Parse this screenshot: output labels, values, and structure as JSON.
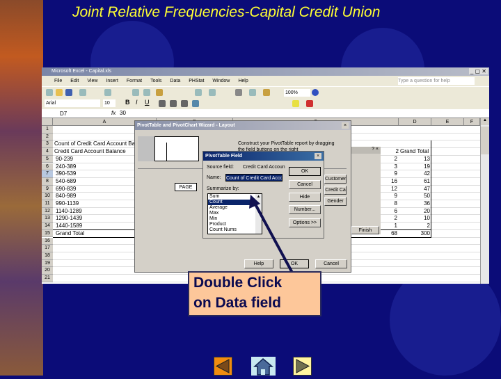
{
  "slide": {
    "title": "Joint Relative Frequencies-Capital Credit Union",
    "callout": "Double Click\non Data field",
    "callout_lines": [
      "Double Click",
      "on Data field"
    ]
  },
  "excel": {
    "window_title": "Microsoft Excel - Capital.xls",
    "menu": [
      "File",
      "Edit",
      "View",
      "Insert",
      "Format",
      "Tools",
      "Data",
      "PHStat",
      "Window",
      "Help"
    ],
    "help_placeholder": "Type a question for help",
    "zoom": "100%",
    "font": "Arial",
    "font_size": "10",
    "name_box": "D7",
    "formula_value": "30",
    "columns": [
      "A",
      "B",
      "C",
      "D",
      "E",
      "F"
    ],
    "rows": [
      "1",
      "2",
      "3",
      "4",
      "5",
      "6",
      "7",
      "8",
      "9",
      "10",
      "11",
      "12",
      "13",
      "14",
      "15",
      "16",
      "17",
      "18",
      "19",
      "20",
      "21"
    ],
    "table": {
      "header": "Count of Credit Card Account Balance",
      "row_label": "Credit Card Account Balance",
      "col_c_header": "2",
      "col_d_header": "Grand Total",
      "categories": [
        "90-239",
        "240-389",
        "390-539",
        "540-689",
        "690-839",
        "840-989",
        "990-1139",
        "1140-1289",
        "1290-1439",
        "1440-1589",
        "Grand Total"
      ],
      "col_c": [
        "2",
        "3",
        "9",
        "16",
        "12",
        "9",
        "8",
        "6",
        "2",
        "1",
        "68"
      ],
      "grand_total": [
        "13",
        "19",
        "42",
        "61",
        "47",
        "50",
        "36",
        "20",
        "10",
        "2",
        "300"
      ]
    }
  },
  "wizard": {
    "title": "PivotTable and PivotChart Wizard - Layout",
    "instructions": "Construct your PivotTable report by dragging the field buttons on the right",
    "page_label": "PAGE",
    "field_buttons": [
      "Customer",
      "Credit Ca",
      "Gender"
    ],
    "finish": "Finish",
    "help": "Help",
    "ok": "OK",
    "cancel": "Cancel"
  },
  "field_dialog": {
    "title": "PivotTable Field",
    "source_label": "Source field:",
    "source_value": "Credit Card Accoun",
    "name_label": "Name:",
    "name_value": "Count of Credit Card Acco",
    "summarize_label": "Summarize by:",
    "options": [
      "Sum",
      "Count",
      "Average",
      "Max",
      "Min",
      "Product",
      "Count Nums"
    ],
    "selected": "Count",
    "buttons": [
      "OK",
      "Cancel",
      "Hide",
      "Number...",
      "Options >>"
    ]
  },
  "nav": {
    "prev": "previous-slide",
    "home": "home",
    "next": "next-slide"
  },
  "colors": {
    "background": "#0b0c78",
    "title": "#ffff33",
    "callout": "#fdc79a",
    "selection": "#0a246a"
  }
}
